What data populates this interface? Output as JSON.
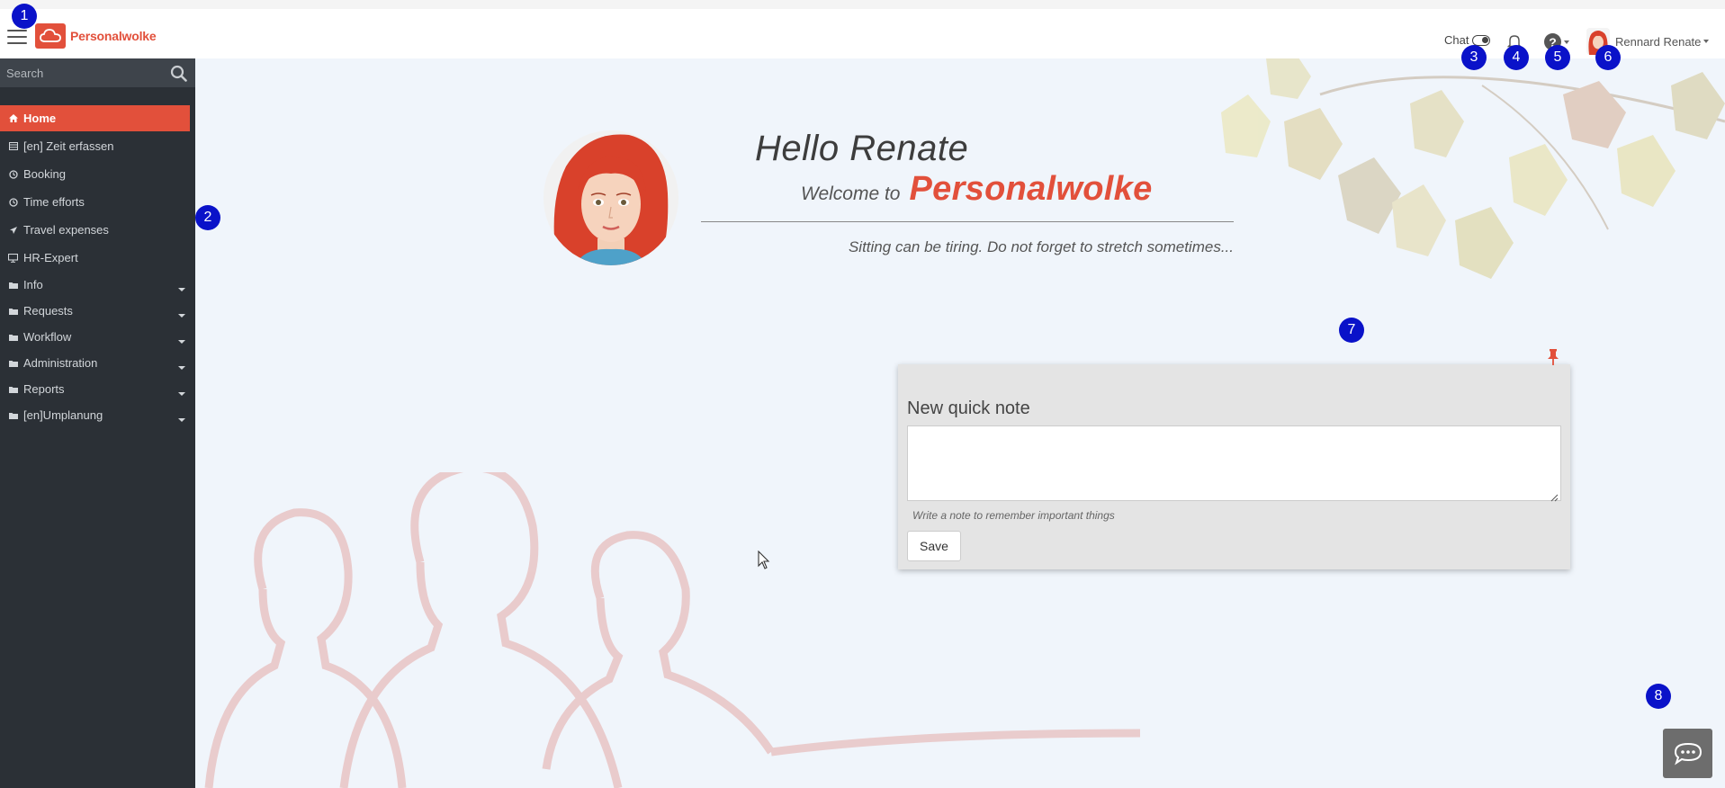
{
  "header": {
    "logo_text": "Personalwolke",
    "chat_label": "Chat",
    "user_name": "Rennard Renate"
  },
  "sidebar": {
    "search_placeholder": "Search",
    "items": [
      {
        "label": "Home",
        "icon": "home-icon",
        "active": true,
        "expandable": false
      },
      {
        "label": "[en] Zeit erfassen",
        "icon": "list-icon",
        "active": false,
        "expandable": false
      },
      {
        "label": "Booking",
        "icon": "clock-icon",
        "active": false,
        "expandable": false
      },
      {
        "label": "Time efforts",
        "icon": "clock-icon",
        "active": false,
        "expandable": false
      },
      {
        "label": "Travel expenses",
        "icon": "plane-icon",
        "active": false,
        "expandable": false
      },
      {
        "label": "HR-Expert",
        "icon": "monitor-icon",
        "active": false,
        "expandable": false
      },
      {
        "label": "Info",
        "icon": "folder-icon",
        "active": false,
        "expandable": true
      },
      {
        "label": "Requests",
        "icon": "folder-icon",
        "active": false,
        "expandable": true
      },
      {
        "label": "Workflow",
        "icon": "folder-icon",
        "active": false,
        "expandable": true
      },
      {
        "label": "Administration",
        "icon": "folder-icon",
        "active": false,
        "expandable": true
      },
      {
        "label": "Reports",
        "icon": "folder-icon",
        "active": false,
        "expandable": true
      },
      {
        "label": "[en]Umplanung",
        "icon": "folder-icon",
        "active": false,
        "expandable": true
      }
    ]
  },
  "welcome": {
    "hello": "Hello Renate",
    "welcome_to": "Welcome to",
    "brand": "Personalwolke",
    "tip": "Sitting can be tiring. Do not forget to stretch sometimes..."
  },
  "quick_note": {
    "title": "New quick note",
    "value": "",
    "hint": "Write a note to remember important things",
    "save_label": "Save"
  },
  "badges": [
    "1",
    "2",
    "3",
    "4",
    "5",
    "6",
    "7",
    "8"
  ],
  "colors": {
    "accent": "#e2503b",
    "sidebar_bg": "#2b3036",
    "badge": "#0a12c9",
    "page_bg": "#f0f5fb"
  }
}
